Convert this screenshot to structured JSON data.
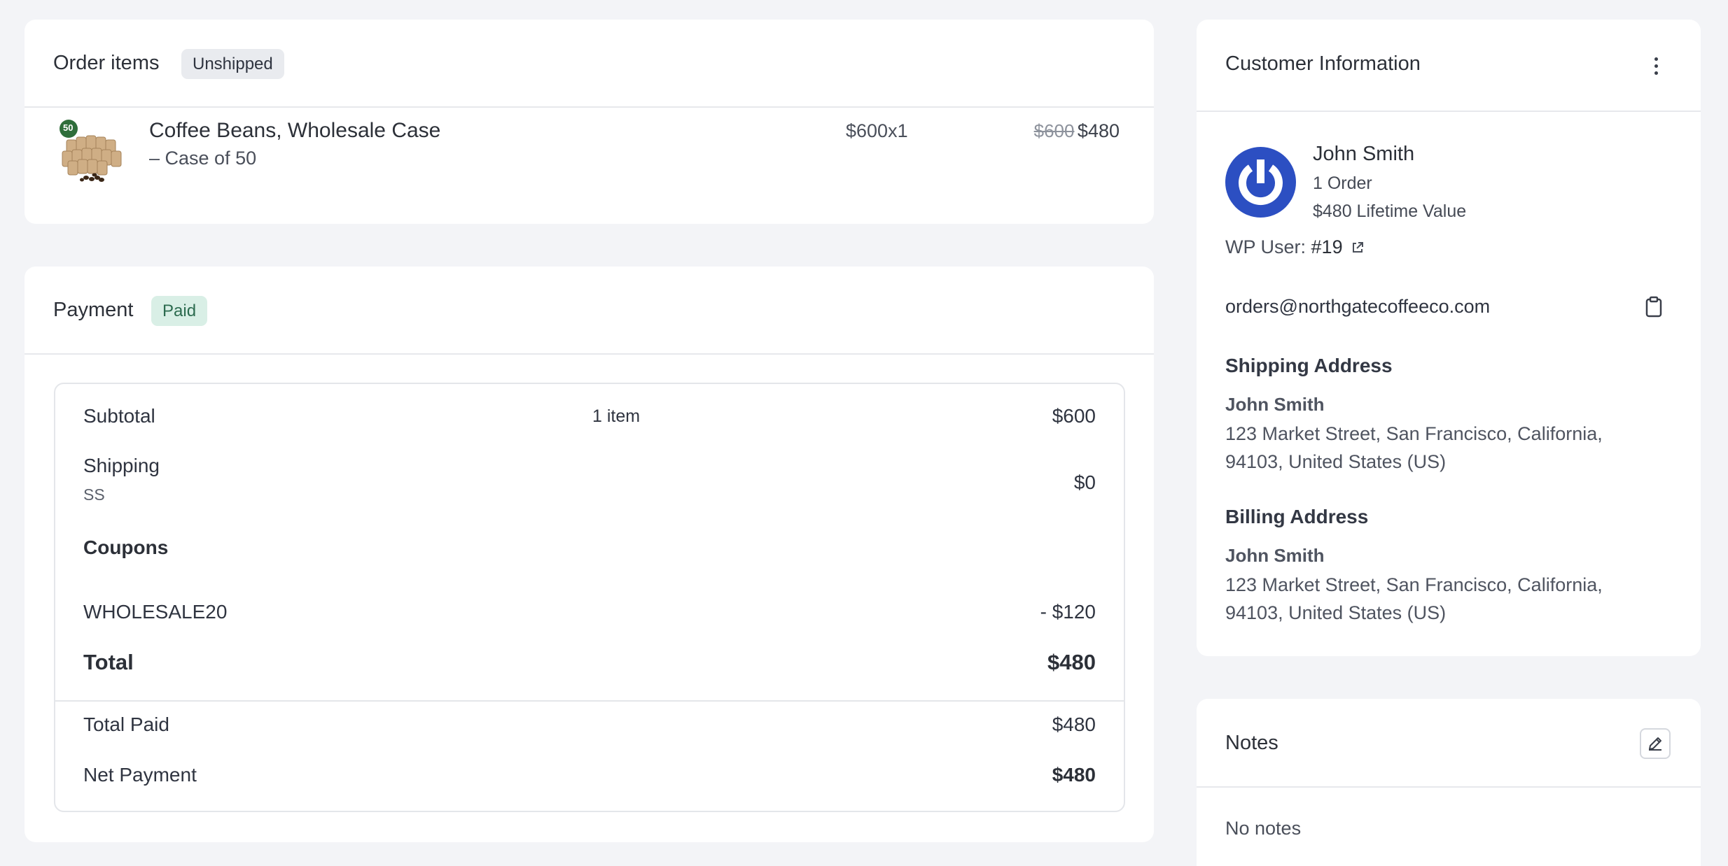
{
  "order_items": {
    "title": "Order items",
    "status_badge": "Unshipped",
    "items": [
      {
        "name": "Coffee Beans, Wholesale Case",
        "variant": "– Case of 50",
        "thumb_badge": "50",
        "price_qty": "$600x1",
        "original_price": "$600",
        "final_price": "$480"
      }
    ]
  },
  "payment": {
    "title": "Payment",
    "status_badge": "Paid",
    "subtotal_label": "Subtotal",
    "subtotal_items": "1 item",
    "subtotal_value": "$600",
    "shipping_label": "Shipping",
    "shipping_method": "SS",
    "shipping_value": "$0",
    "coupons_label": "Coupons",
    "coupon_code": "WHOLESALE20",
    "coupon_value": "- $120",
    "total_label": "Total",
    "total_value": "$480",
    "total_paid_label": "Total Paid",
    "total_paid_value": "$480",
    "net_payment_label": "Net Payment",
    "net_payment_value": "$480"
  },
  "customer": {
    "title": "Customer Information",
    "name": "John Smith",
    "orders": "1 Order",
    "lifetime_value": "$480 Lifetime Value",
    "wp_user_label": "WP User:",
    "wp_user_id": "#19",
    "email": "orders@northgatecoffeeco.com",
    "shipping_heading": "Shipping Address",
    "shipping_name": "John Smith",
    "shipping_address": "123 Market Street, San Francisco, California, 94103, United States (US)",
    "billing_heading": "Billing Address",
    "billing_name": "John Smith",
    "billing_address": "123 Market Street, San Francisco, California, 94103, United States (US)"
  },
  "notes": {
    "title": "Notes",
    "empty_text": "No notes"
  },
  "icons": {
    "more": "more-vertical-icon",
    "external": "external-link-icon",
    "copy": "clipboard-icon",
    "edit": "pencil-icon",
    "avatar": "power-icon"
  },
  "colors": {
    "avatar_blue": "#2c4fc2",
    "paid_bg": "#d9efe6",
    "paid_text": "#2c6b4f",
    "unshipped_bg": "#e9ebef"
  }
}
